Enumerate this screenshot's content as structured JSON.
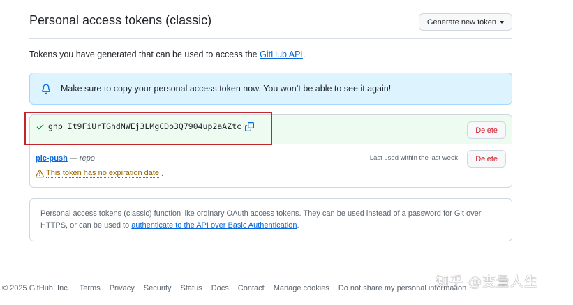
{
  "header": {
    "title": "Personal access tokens (classic)",
    "generate_button": "Generate new token"
  },
  "intro": {
    "text": "Tokens you have generated that can be used to access the ",
    "link": "GitHub API",
    "suffix": "."
  },
  "flash": {
    "message": "Make sure to copy your personal access token now. You won’t be able to see it again!"
  },
  "new_token": {
    "value": "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",
    "delete_label": "Delete"
  },
  "tokens": [
    {
      "name": "pic-push",
      "dash": " — ",
      "scope": "repo",
      "last_used": "Last used within the last week",
      "warning": "This token has no expiration date",
      "warning_suffix": ".",
      "delete_label": "Delete"
    }
  ],
  "note": {
    "text": "Personal access tokens (classic) function like ordinary OAuth access tokens. They can be used instead of a password for Git over HTTPS, or can be used to ",
    "link": "authenticate to the API over Basic Authentication",
    "suffix": "."
  },
  "footer": {
    "copyright": "© 2025 GitHub, Inc.",
    "links": [
      "Terms",
      "Privacy",
      "Security",
      "Status",
      "Docs",
      "Contact",
      "Manage cookies",
      "Do not share my personal information"
    ]
  },
  "watermark": "知乎 @变量人生",
  "colors": {
    "accent": "#0969da",
    "danger": "#cf222e",
    "warning": "#9a6700",
    "success": "#1a7f37",
    "flash_bg": "#ddf4ff",
    "highlight": "#c0272d"
  }
}
